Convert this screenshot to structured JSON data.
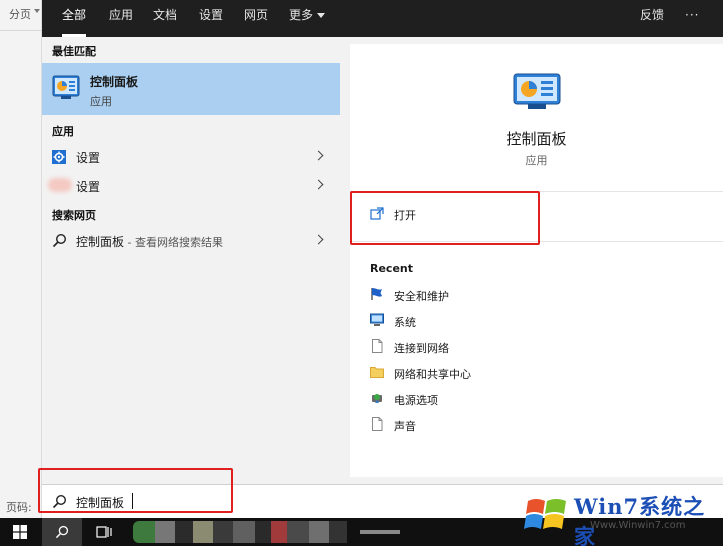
{
  "background_doc": {
    "tab_label": "分页",
    "status_label": "页码:"
  },
  "filter_tabs": [
    {
      "label": "全部"
    },
    {
      "label": "应用"
    },
    {
      "label": "文档"
    },
    {
      "label": "设置"
    },
    {
      "label": "网页"
    },
    {
      "label": "更多"
    }
  ],
  "header_right": {
    "feedback_label": "反馈",
    "more_options": "···"
  },
  "results": {
    "best_match_title": "最佳匹配",
    "best_match": {
      "name": "控制面板",
      "type": "应用",
      "icon": "control-panel-icon"
    },
    "apps_title": "应用",
    "apps": [
      {
        "label": "设置",
        "icon": "gear-icon"
      },
      {
        "label": "设置",
        "icon": "blurred-app-icon"
      }
    ],
    "web_title": "搜索网页",
    "web_item": {
      "label": "控制面板",
      "suffix": " - 查看网络搜索结果",
      "icon": "search-icon"
    }
  },
  "preview": {
    "name": "控制面板",
    "type": "应用",
    "open_label": "打开",
    "recent_title": "Recent",
    "recent_items": [
      {
        "label": "安全和维护",
        "icon": "flag-icon"
      },
      {
        "label": "系统",
        "icon": "monitor-icon"
      },
      {
        "label": "连接到网络",
        "icon": "document-icon"
      },
      {
        "label": "网络和共享中心",
        "icon": "folder-icon"
      },
      {
        "label": "电源选项",
        "icon": "power-options-icon"
      },
      {
        "label": "声音",
        "icon": "document-icon"
      }
    ]
  },
  "search": {
    "value": "控制面板",
    "icon": "search-icon"
  },
  "watermark": {
    "brand": "Win7系统之家",
    "url": "Www.Winwin7.com"
  },
  "colors": {
    "header_bg": "#1f1f1f",
    "best_match_highlight": "#aacff0",
    "annotation_red": "#e01f1f",
    "taskbar_bg": "#101010"
  }
}
